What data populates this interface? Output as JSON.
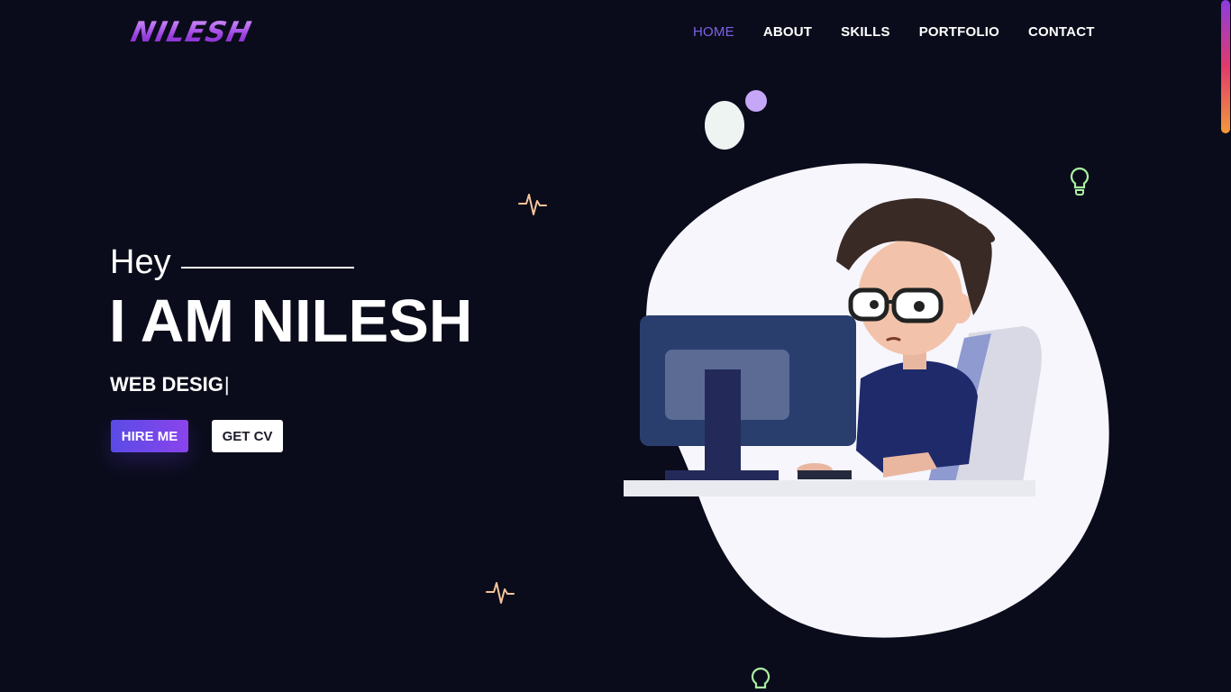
{
  "header": {
    "logo": "NILESH",
    "nav": [
      {
        "label": "HOME",
        "active": true
      },
      {
        "label": "ABOUT",
        "active": false
      },
      {
        "label": "SKILLS",
        "active": false
      },
      {
        "label": "PORTFOLIO",
        "active": false
      },
      {
        "label": "CONTACT",
        "active": false
      }
    ]
  },
  "hero": {
    "greeting": "Hey",
    "headline": "I AM NILESH",
    "typed_role": "WEB DESIG",
    "buttons": {
      "hire": "HIRE ME",
      "cv": "GET CV"
    }
  },
  "decorations": {
    "icons": [
      "heartbeat-icon",
      "lightbulb-icon",
      "dot-icon"
    ],
    "illustration": "developer-at-computer-illustration"
  },
  "colors": {
    "background": "#0b0c1b",
    "accent": "#7b62e8",
    "button_gradient_start": "#5a4be6",
    "button_gradient_end": "#8a44ec",
    "logo": "#b062ea",
    "blob": "#f6f6fc",
    "heartbeat": "#f5c49a",
    "lightbulb": "#a9f0a3"
  }
}
